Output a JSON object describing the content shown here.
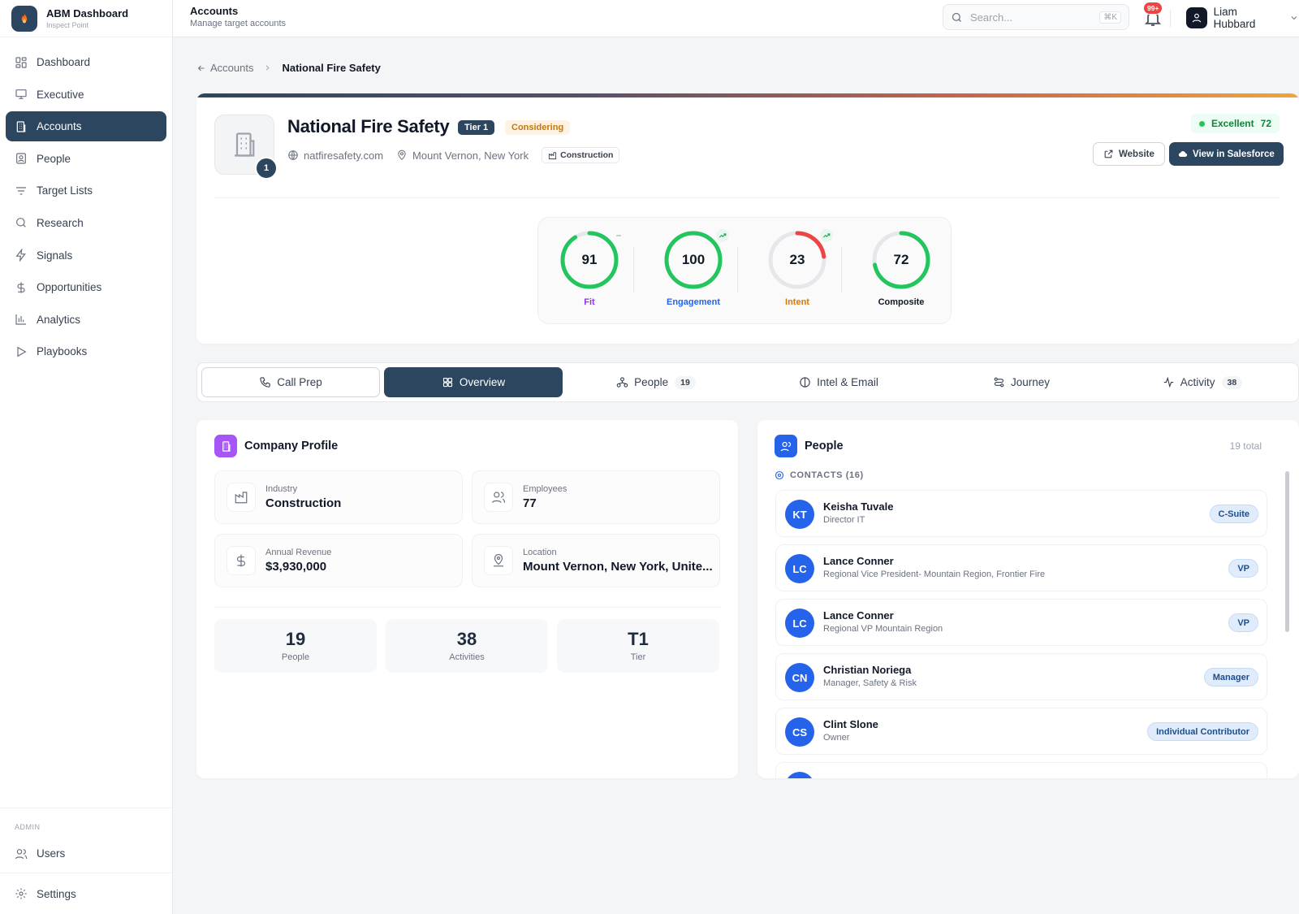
{
  "brand": {
    "title": "ABM Dashboard",
    "subtitle": "Inspect Point"
  },
  "nav": [
    {
      "label": "Dashboard",
      "icon": "grid-icon"
    },
    {
      "label": "Executive",
      "icon": "monitor-icon"
    },
    {
      "label": "Accounts",
      "icon": "building-icon",
      "active": true
    },
    {
      "label": "People",
      "icon": "contact-icon"
    },
    {
      "label": "Target Lists",
      "icon": "filter-icon"
    },
    {
      "label": "Research",
      "icon": "search-icon"
    },
    {
      "label": "Signals",
      "icon": "zap-icon"
    },
    {
      "label": "Opportunities",
      "icon": "dollar-icon"
    },
    {
      "label": "Analytics",
      "icon": "bar-chart-icon"
    },
    {
      "label": "Playbooks",
      "icon": "play-icon"
    }
  ],
  "admin": {
    "section_label": "ADMIN",
    "users_label": "Users",
    "settings_label": "Settings"
  },
  "header": {
    "title": "Accounts",
    "subtitle": "Manage target accounts"
  },
  "search": {
    "placeholder": "Search...",
    "shortcut": "⌘K"
  },
  "notifications": {
    "count": "99+"
  },
  "user": {
    "name": "Liam Hubbard"
  },
  "breadcrumb": {
    "parent": "Accounts",
    "current": "National Fire Safety"
  },
  "account": {
    "name": "National Fire Safety",
    "tier": "Tier 1",
    "status": "Considering",
    "logo_badge": "1",
    "website": "natfiresafety.com",
    "location": "Mount Vernon, New York",
    "industry": "Construction",
    "rating_label": "Excellent",
    "rating_score": "72",
    "website_button": "Website",
    "salesforce_button": "View in Salesforce"
  },
  "scores": [
    {
      "label": "Fit",
      "value": 91,
      "color": "#22c55e",
      "label_color": "#9333ea",
      "trend": "flat"
    },
    {
      "label": "Engagement",
      "value": 100,
      "color": "#22c55e",
      "label_color": "#2563eb",
      "trend": "up"
    },
    {
      "label": "Intent",
      "value": 23,
      "color": "#ef4444",
      "label_color": "#d97706",
      "trend": "up"
    },
    {
      "label": "Composite",
      "value": 72,
      "color": "#22c55e",
      "label_color": "#111827",
      "trend": "none"
    }
  ],
  "tabs": [
    {
      "label": "Call Prep",
      "count": ""
    },
    {
      "label": "Overview",
      "count": "",
      "active": true
    },
    {
      "label": "People",
      "count": "19"
    },
    {
      "label": "Intel & Email",
      "count": ""
    },
    {
      "label": "Journey",
      "count": ""
    },
    {
      "label": "Activity",
      "count": "38"
    }
  ],
  "company_profile": {
    "title": "Company Profile",
    "facts": [
      {
        "label": "Industry",
        "value": "Construction"
      },
      {
        "label": "Employees",
        "value": "77"
      },
      {
        "label": "Annual Revenue",
        "value": "$3,930,000"
      },
      {
        "label": "Location",
        "value": "Mount Vernon, New York, Unite..."
      }
    ],
    "stats": [
      {
        "value": "19",
        "label": "People"
      },
      {
        "value": "38",
        "label": "Activities"
      },
      {
        "value": "T1",
        "label": "Tier"
      }
    ]
  },
  "people_panel": {
    "title": "People",
    "total": "19 total",
    "contacts_label": "CONTACTS (16)",
    "contacts": [
      {
        "initials": "KT",
        "name": "Keisha Tuvale",
        "title": "Director IT",
        "badge": "C-Suite"
      },
      {
        "initials": "LC",
        "name": "Lance Conner",
        "title": "Regional Vice President- Mountain Region, Frontier Fire",
        "badge": "VP"
      },
      {
        "initials": "LC",
        "name": "Lance Conner",
        "title": "Regional VP Mountain Region",
        "badge": "VP"
      },
      {
        "initials": "CN",
        "name": "Christian Noriega",
        "title": "Manager, Safety & Risk",
        "badge": "Manager"
      },
      {
        "initials": "CS",
        "name": "Clint Slone",
        "title": "Owner",
        "badge": "Individual Contributor"
      }
    ]
  }
}
